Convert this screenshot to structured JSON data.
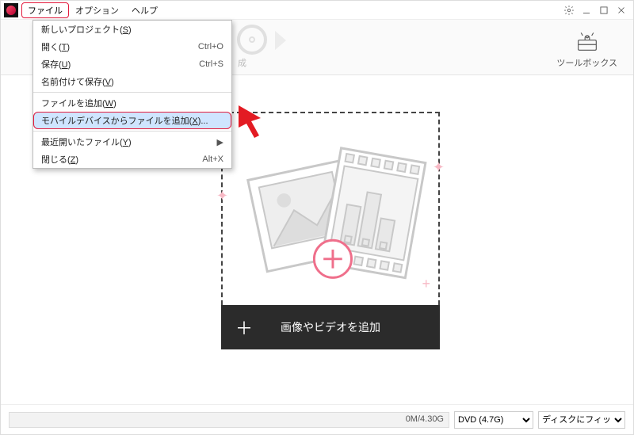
{
  "menubar": {
    "items": [
      "ファイル",
      "オプション",
      "ヘルプ"
    ]
  },
  "window_controls": {
    "settings_tip": "設定",
    "minimize_tip": "最小化",
    "maximize_tip": "最大化",
    "close_tip": "閉じる"
  },
  "ribbon": {
    "hidden_step_label": "成",
    "toolbox_label": "ツールボックス"
  },
  "file_menu": {
    "items": [
      {
        "label": "新しいプロジェクト(",
        "key": "S",
        "tail": ")",
        "accel": "",
        "sub": false
      },
      {
        "label": "開く(",
        "key": "T",
        "tail": ")",
        "accel": "Ctrl+O",
        "sub": false
      },
      {
        "label": "保存(",
        "key": "U",
        "tail": ")",
        "accel": "Ctrl+S",
        "sub": false
      },
      {
        "label": "名前付けて保存(",
        "key": "V",
        "tail": ")",
        "accel": "",
        "sub": false
      }
    ],
    "items2": [
      {
        "label": "ファイルを追加(",
        "key": "W",
        "tail": ")",
        "accel": "",
        "sub": false
      },
      {
        "label": "モバイルデバイスからファイルを追加(",
        "key": "X",
        "tail": ")...",
        "accel": "",
        "sub": false,
        "selected": true
      }
    ],
    "items3": [
      {
        "label": "最近開いたファイル(",
        "key": "Y",
        "tail": ")",
        "accel": "",
        "sub": true
      },
      {
        "label": "閉じる(",
        "key": "Z",
        "tail": ")",
        "accel": "Alt+X",
        "sub": false
      }
    ]
  },
  "dropzone": {
    "button_label": "画像やビデオを追加",
    "plus": "＋"
  },
  "status": {
    "usage": "0M/4.30G",
    "disc_type": "DVD (4.7G)",
    "fit_mode": "ディスクにフィット"
  }
}
